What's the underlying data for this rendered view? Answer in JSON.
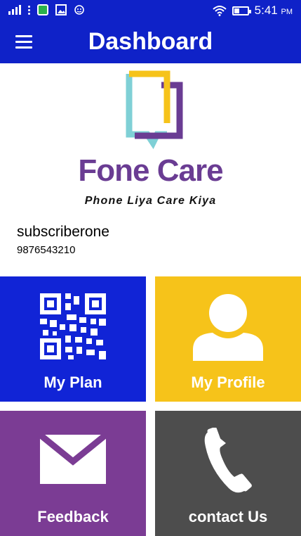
{
  "status_bar": {
    "time": "5:41",
    "ampm": "PM",
    "icons": [
      "signal-icon",
      "more-dots-icon",
      "app-notification-icon",
      "image-icon",
      "smiley-icon",
      "wifi-icon",
      "battery-icon"
    ]
  },
  "app_bar": {
    "title": "Dashboard",
    "menu_icon": "hamburger-menu-icon"
  },
  "brand": {
    "name": "Fone Care",
    "tagline": "Phone Liya Care Kiya",
    "colors": {
      "purple": "#6a3c93",
      "yellow": "#f6c31a",
      "teal": "#7fd0d6"
    }
  },
  "user": {
    "name": "subscriberone",
    "phone": "9876543210"
  },
  "tiles": [
    {
      "label": "My Plan",
      "icon": "qr-code-icon",
      "color": "#1124d6"
    },
    {
      "label": "My Profile",
      "icon": "user-profile-icon",
      "color": "#f6c31a"
    },
    {
      "label": "Feedback",
      "icon": "envelope-icon",
      "color": "#7b3c94"
    },
    {
      "label": "contact Us",
      "icon": "phone-icon",
      "color": "#4d4d4d"
    }
  ]
}
